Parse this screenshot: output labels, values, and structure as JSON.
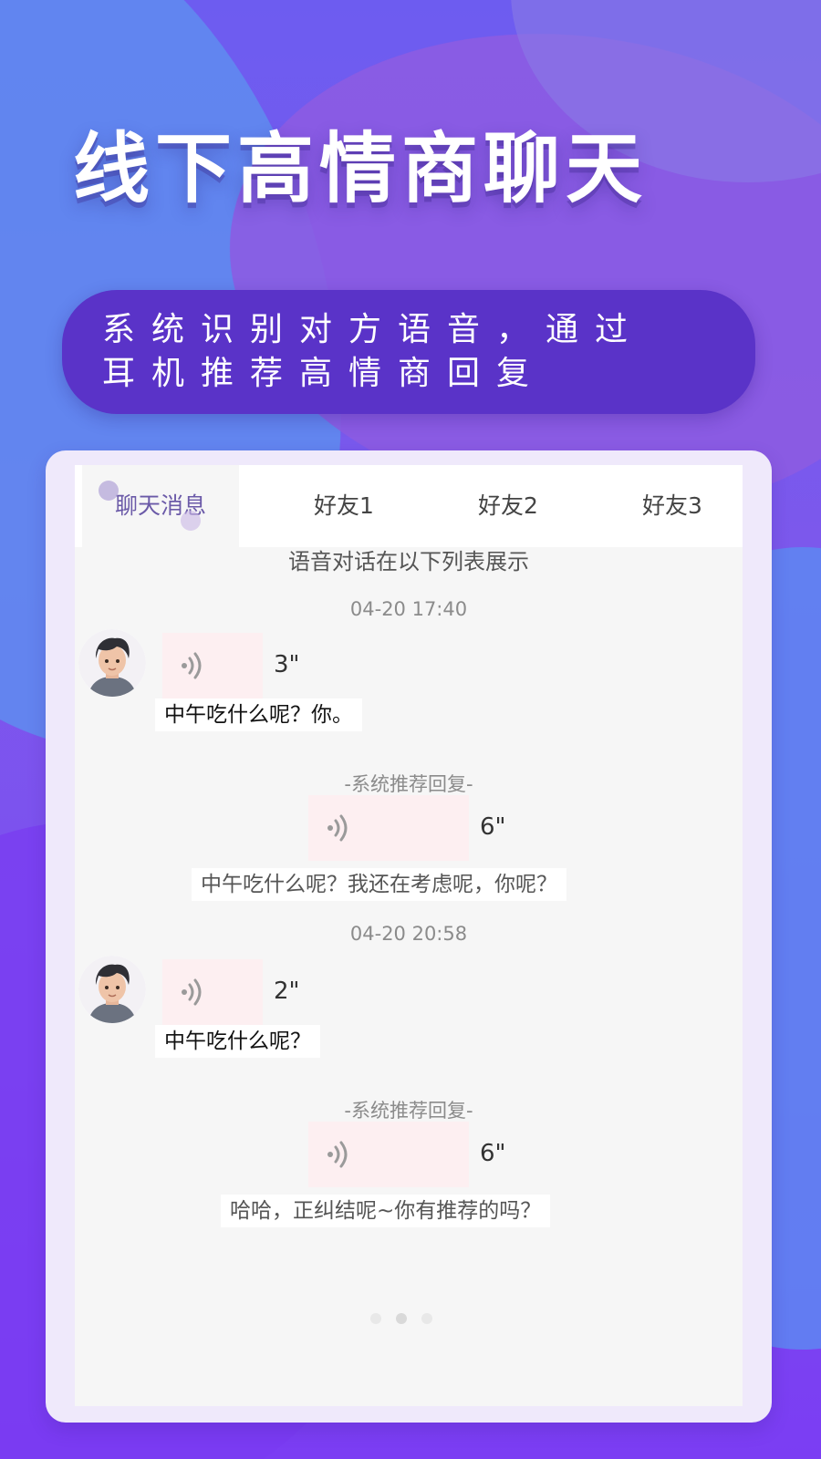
{
  "headline": "线下高情商聊天",
  "banner": {
    "line1": "系统识别对方语音，通过",
    "line2": "耳机推荐高情商回复"
  },
  "tabs": [
    {
      "label": "聊天消息",
      "active": true
    },
    {
      "label": "好友1",
      "active": false
    },
    {
      "label": "好友2",
      "active": false
    },
    {
      "label": "好友3",
      "active": false
    }
  ],
  "chat": {
    "subtitle": "语音对话在以下列表展示",
    "groups": [
      {
        "timestamp": "04-20 17:40",
        "incoming": {
          "duration": "3\"",
          "text": "中午吃什么呢？你。"
        },
        "system_label": "-系统推荐回复-",
        "reply": {
          "duration": "6\"",
          "text": "中午吃什么呢？我还在考虑呢，你呢？"
        }
      },
      {
        "timestamp": "04-20 20:58",
        "incoming": {
          "duration": "2\"",
          "text": "中午吃什么呢？"
        },
        "system_label": "-系统推荐回复-",
        "reply": {
          "duration": "6\"",
          "text": "哈哈，正纠结呢~你有推荐的吗？"
        }
      }
    ]
  },
  "pager": {
    "count": 3,
    "active_index": 1
  },
  "colors": {
    "banner": "#5a33c8",
    "active_tab_text": "#6b5aa8",
    "voice_bubble": "#fdeff1"
  },
  "icons": [
    "avatar-icon",
    "voice-wave-icon"
  ]
}
